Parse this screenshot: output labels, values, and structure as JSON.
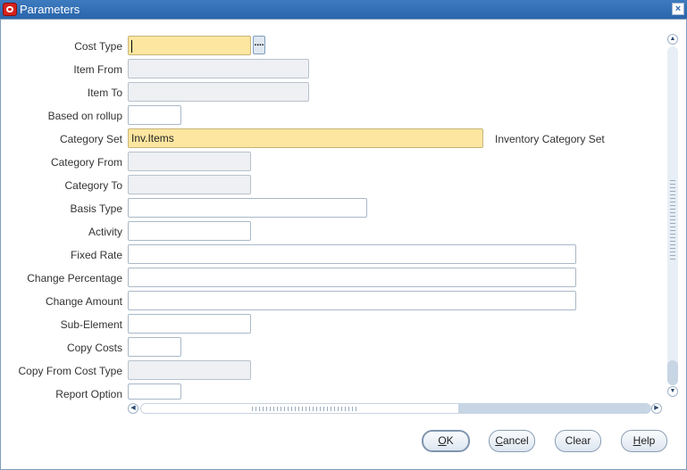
{
  "window": {
    "title": "Parameters",
    "close": "×",
    "lov_button": "...."
  },
  "fields": [
    {
      "label": "Cost Type",
      "value": ""
    },
    {
      "label": "Item From",
      "value": ""
    },
    {
      "label": "Item To",
      "value": ""
    },
    {
      "label": "Based on rollup",
      "value": ""
    },
    {
      "label": "Category Set",
      "value": "Inv.Items",
      "description": "Inventory Category Set"
    },
    {
      "label": "Category From",
      "value": ""
    },
    {
      "label": "Category To",
      "value": ""
    },
    {
      "label": "Basis Type",
      "value": ""
    },
    {
      "label": "Activity",
      "value": ""
    },
    {
      "label": "Fixed Rate",
      "value": ""
    },
    {
      "label": "Change Percentage",
      "value": ""
    },
    {
      "label": "Change Amount",
      "value": ""
    },
    {
      "label": "Sub-Element",
      "value": ""
    },
    {
      "label": "Copy Costs",
      "value": ""
    },
    {
      "label": "Copy From Cost Type",
      "value": ""
    },
    {
      "label": "Report Option",
      "value": ""
    }
  ],
  "buttons": {
    "ok": {
      "first": "O",
      "rest": "K"
    },
    "cancel": {
      "first": "C",
      "rest": "ancel"
    },
    "clear": {
      "label": "Clear"
    },
    "help": {
      "first": "H",
      "rest": "elp"
    }
  },
  "scroll": {
    "up": "▲",
    "down": "▼",
    "left": "◀",
    "right": "▶"
  },
  "colors": {
    "titlebar": "#2a66ab",
    "required_field": "#fde6a0",
    "disabled_field": "#eef0f3"
  }
}
